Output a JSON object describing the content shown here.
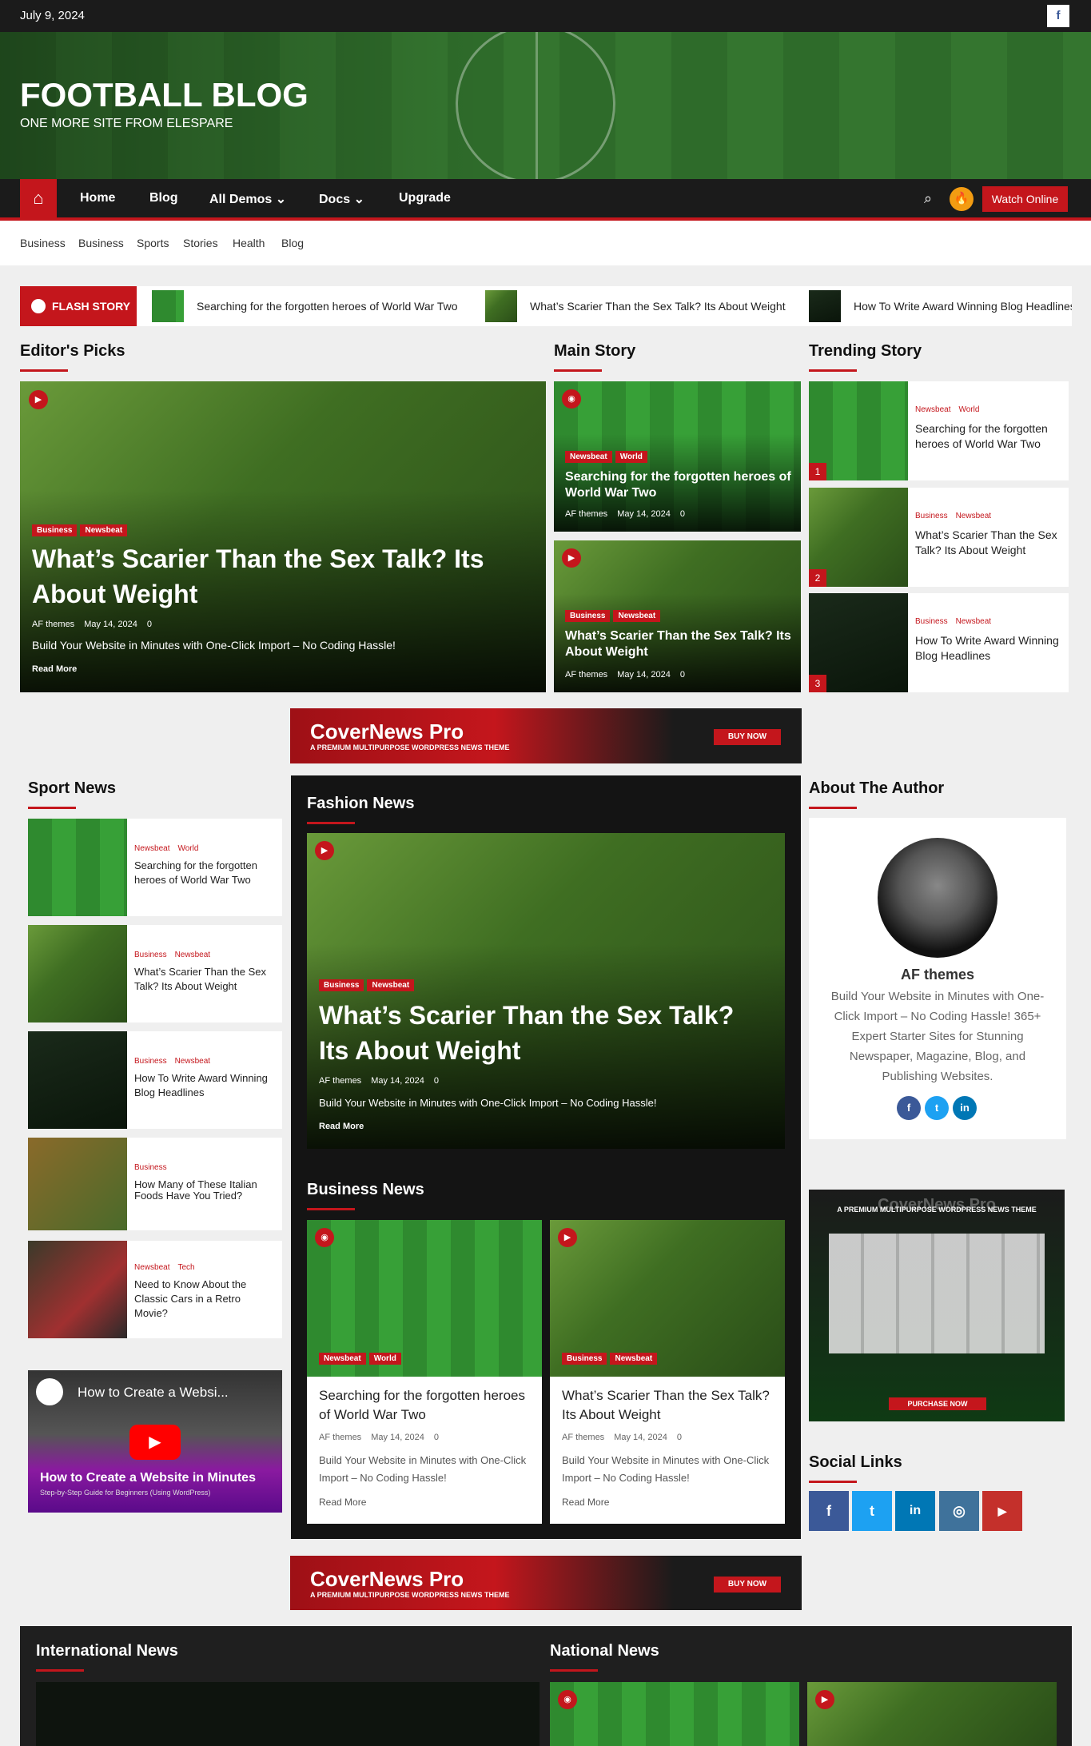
{
  "topbar": {
    "date": "July 9, 2024",
    "facebook_icon": "f"
  },
  "site": {
    "title": "FOOTBALL BLOG",
    "tagline": "ONE MORE SITE FROM ELESPARE"
  },
  "nav": {
    "home_icon": "⌂",
    "items": [
      "Home",
      "Blog",
      "All Demos ⌄",
      "Docs ⌄",
      "Upgrade"
    ],
    "search_icon": "⌕",
    "fire_icon": "🔥",
    "watch_label": "Watch Online"
  },
  "subnav": [
    "Business",
    "Business",
    "Sports",
    "Stories",
    "Health",
    "Blog"
  ],
  "flash": {
    "label": "FLASH STORY",
    "items": [
      "Searching for the forgotten heroes of World War Two",
      "What’s Scarier Than the Sex Talk? Its About Weight",
      "How To Write Award Winning Blog Headlines"
    ]
  },
  "sections": {
    "editors": "Editor's Picks",
    "main": "Main Story",
    "trending": "Trending Story",
    "sport": "Sport News",
    "fashion": "Fashion News",
    "about": "About The Author",
    "business": "Business News",
    "social": "Social Links",
    "international": "International News",
    "national": "National News"
  },
  "editor_pick": {
    "tags": [
      "Business",
      "Newsbeat"
    ],
    "title": "What’s Scarier Than the Sex Talk? Its About Weight",
    "author": "AF themes",
    "date": "May 14, 2024",
    "comments": "0",
    "excerpt": "Build Your Website in Minutes with One-Click Import – No Coding Hassle!",
    "read_more": "Read More"
  },
  "main_story": [
    {
      "tags": [
        "Newsbeat",
        "World"
      ],
      "title": "Searching for the forgotten heroes of World War Two",
      "author": "AF themes",
      "date": "May 14, 2024",
      "comments": "0"
    },
    {
      "tags": [
        "Business",
        "Newsbeat"
      ],
      "title": "What’s Scarier Than the Sex Talk? Its About Weight",
      "author": "AF themes",
      "date": "May 14, 2024",
      "comments": "0"
    }
  ],
  "trending": [
    {
      "num": "1",
      "cats": [
        "Newsbeat",
        "World"
      ],
      "title": "Searching for the forgotten heroes of World War Two"
    },
    {
      "num": "2",
      "cats": [
        "Business",
        "Newsbeat"
      ],
      "title": "What’s Scarier Than the Sex Talk? Its About Weight"
    },
    {
      "num": "3",
      "cats": [
        "Business",
        "Newsbeat"
      ],
      "title": "How To Write Award Winning Blog Headlines"
    }
  ],
  "ad": {
    "title": "CoverNews Pro",
    "subtitle": "A PREMIUM MULTIPURPOSE WORDPRESS NEWS THEME",
    "button": "BUY NOW"
  },
  "sport_news": [
    {
      "cats": [
        "Newsbeat",
        "World"
      ],
      "title": "Searching for the forgotten heroes of World War Two"
    },
    {
      "cats": [
        "Business",
        "Newsbeat"
      ],
      "title": "What’s Scarier Than the Sex Talk? Its About Weight"
    },
    {
      "cats": [
        "Business",
        "Newsbeat"
      ],
      "title": "How To Write Award Winning Blog Headlines"
    },
    {
      "cats": [
        "Business"
      ],
      "title": "How Many of These Italian Foods Have You Tried?"
    },
    {
      "cats": [
        "Newsbeat",
        "Tech"
      ],
      "title": "Need to Know About the Classic Cars in a Retro Movie?"
    }
  ],
  "video": {
    "title": "How to Create a Websi...",
    "overlay": "How to Create a Website in Minutes",
    "overlay_sub": "Step-by-Step Guide for Beginners (Using WordPress)"
  },
  "fashion": {
    "tags": [
      "Business",
      "Newsbeat"
    ],
    "title": "What’s Scarier Than the Sex Talk? Its About Weight",
    "author": "AF themes",
    "date": "May 14, 2024",
    "comments": "0",
    "excerpt": "Build Your Website in Minutes with One-Click Import – No Coding Hassle!",
    "read_more": "Read More"
  },
  "business": [
    {
      "tags": [
        "Newsbeat",
        "World"
      ],
      "title": "Searching for the forgotten heroes of World War Two",
      "author": "AF themes",
      "date": "May 14, 2024",
      "comments": "0",
      "excerpt": "Build Your Website in Minutes with One-Click Import – No Coding Hassle!",
      "read_more": "Read More"
    },
    {
      "tags": [
        "Business",
        "Newsbeat"
      ],
      "title": "What’s Scarier Than the Sex Talk? Its About Weight",
      "author": "AF themes",
      "date": "May 14, 2024",
      "comments": "0",
      "excerpt": "Build Your Website in Minutes with One-Click Import – No Coding Hassle!",
      "read_more": "Read More"
    }
  ],
  "author": {
    "name": "AF themes",
    "bio": "Build Your Website in Minutes with One-Click Import – No Coding Hassle! 365+ Expert Starter Sites for Stunning Newspaper, Magazine, Blog, and Publishing Websites.",
    "socials": [
      "f",
      "t",
      "in"
    ]
  },
  "side_ad": {
    "title": "CoverNews Pro",
    "subtitle": "A PREMIUM MULTIPURPOSE WORDPRESS NEWS THEME",
    "button": "PURCHASE NOW"
  },
  "social_links": [
    {
      "icon": "f",
      "color": "#3b5998"
    },
    {
      "icon": "t",
      "color": "#1da1f2"
    },
    {
      "icon": "in",
      "color": "#0077b5"
    },
    {
      "icon": "◎",
      "color": "#3f729b"
    },
    {
      "icon": "▶",
      "color": "#c4302b"
    }
  ],
  "colors": {
    "accent": "#c4161c",
    "dark": "#1b1b1b"
  }
}
